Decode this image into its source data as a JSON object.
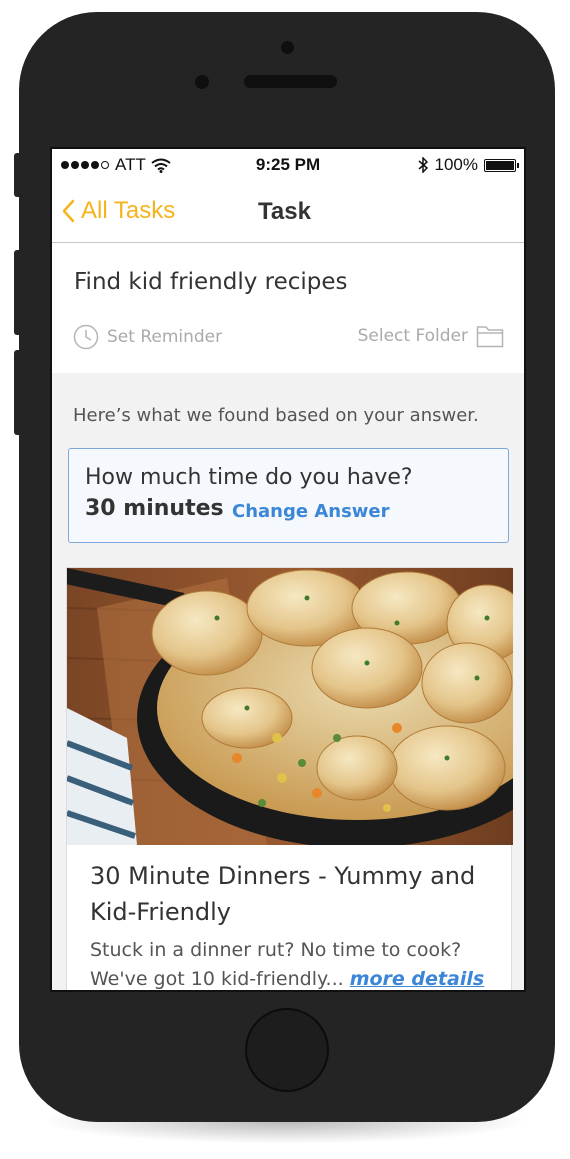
{
  "status_bar": {
    "carrier": "ATT",
    "time": "9:25 PM",
    "battery": "100%",
    "signal_icon": "signal-dots-icon",
    "wifi_icon": "wifi-icon",
    "bluetooth_icon": "bluetooth-icon",
    "battery_icon": "battery-icon"
  },
  "nav": {
    "back_label": "All Tasks",
    "title": "Task",
    "accent_color": "#f5b41d"
  },
  "task": {
    "title": "Find kid friendly recipes",
    "reminder_label": "Set Reminder",
    "folder_label": "Select Folder"
  },
  "results": {
    "intro": "Here’s what we found based on your answer.",
    "question": "How much time do you have?",
    "answer": "30 minutes",
    "change_label": "Change Answer",
    "link_color": "#3b86d6"
  },
  "recipe": {
    "title": "30 Minute Dinners - Yummy and Kid-Friendly",
    "description": "Stuck in a dinner rut? No time to cook? We've got 10 kid-friendly...",
    "more_label": "more details"
  }
}
